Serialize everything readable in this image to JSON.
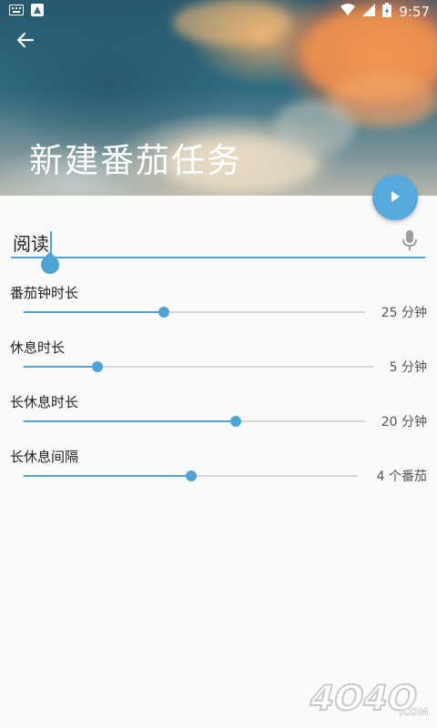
{
  "status_bar": {
    "time": "9:57",
    "icons": [
      "keyboard-icon",
      "android-notification-icon",
      "wifi-icon",
      "signal-icon",
      "battery-icon"
    ]
  },
  "header": {
    "title": "新建番茄任务",
    "back_icon": "arrow-back-icon",
    "fab_icon": "play-icon"
  },
  "task_input": {
    "value": "阅读",
    "mic_icon": "mic-icon"
  },
  "settings": [
    {
      "label": "番茄钟时长",
      "value_text": "25 分钟",
      "fraction": 0.41
    },
    {
      "label": "休息时长",
      "value_text": "5 分钟",
      "fraction": 0.21
    },
    {
      "label": "长休息时长",
      "value_text": "20 分钟",
      "fraction": 0.62
    },
    {
      "label": "长休息间隔",
      "value_text": "4 个番茄",
      "fraction": 0.5
    }
  ],
  "watermark": {
    "text": "4O4O",
    "suffix": ".COM"
  },
  "colors": {
    "accent": "#4ea3d6",
    "fab": "#56a9dd",
    "track": "#d6d6d6"
  }
}
